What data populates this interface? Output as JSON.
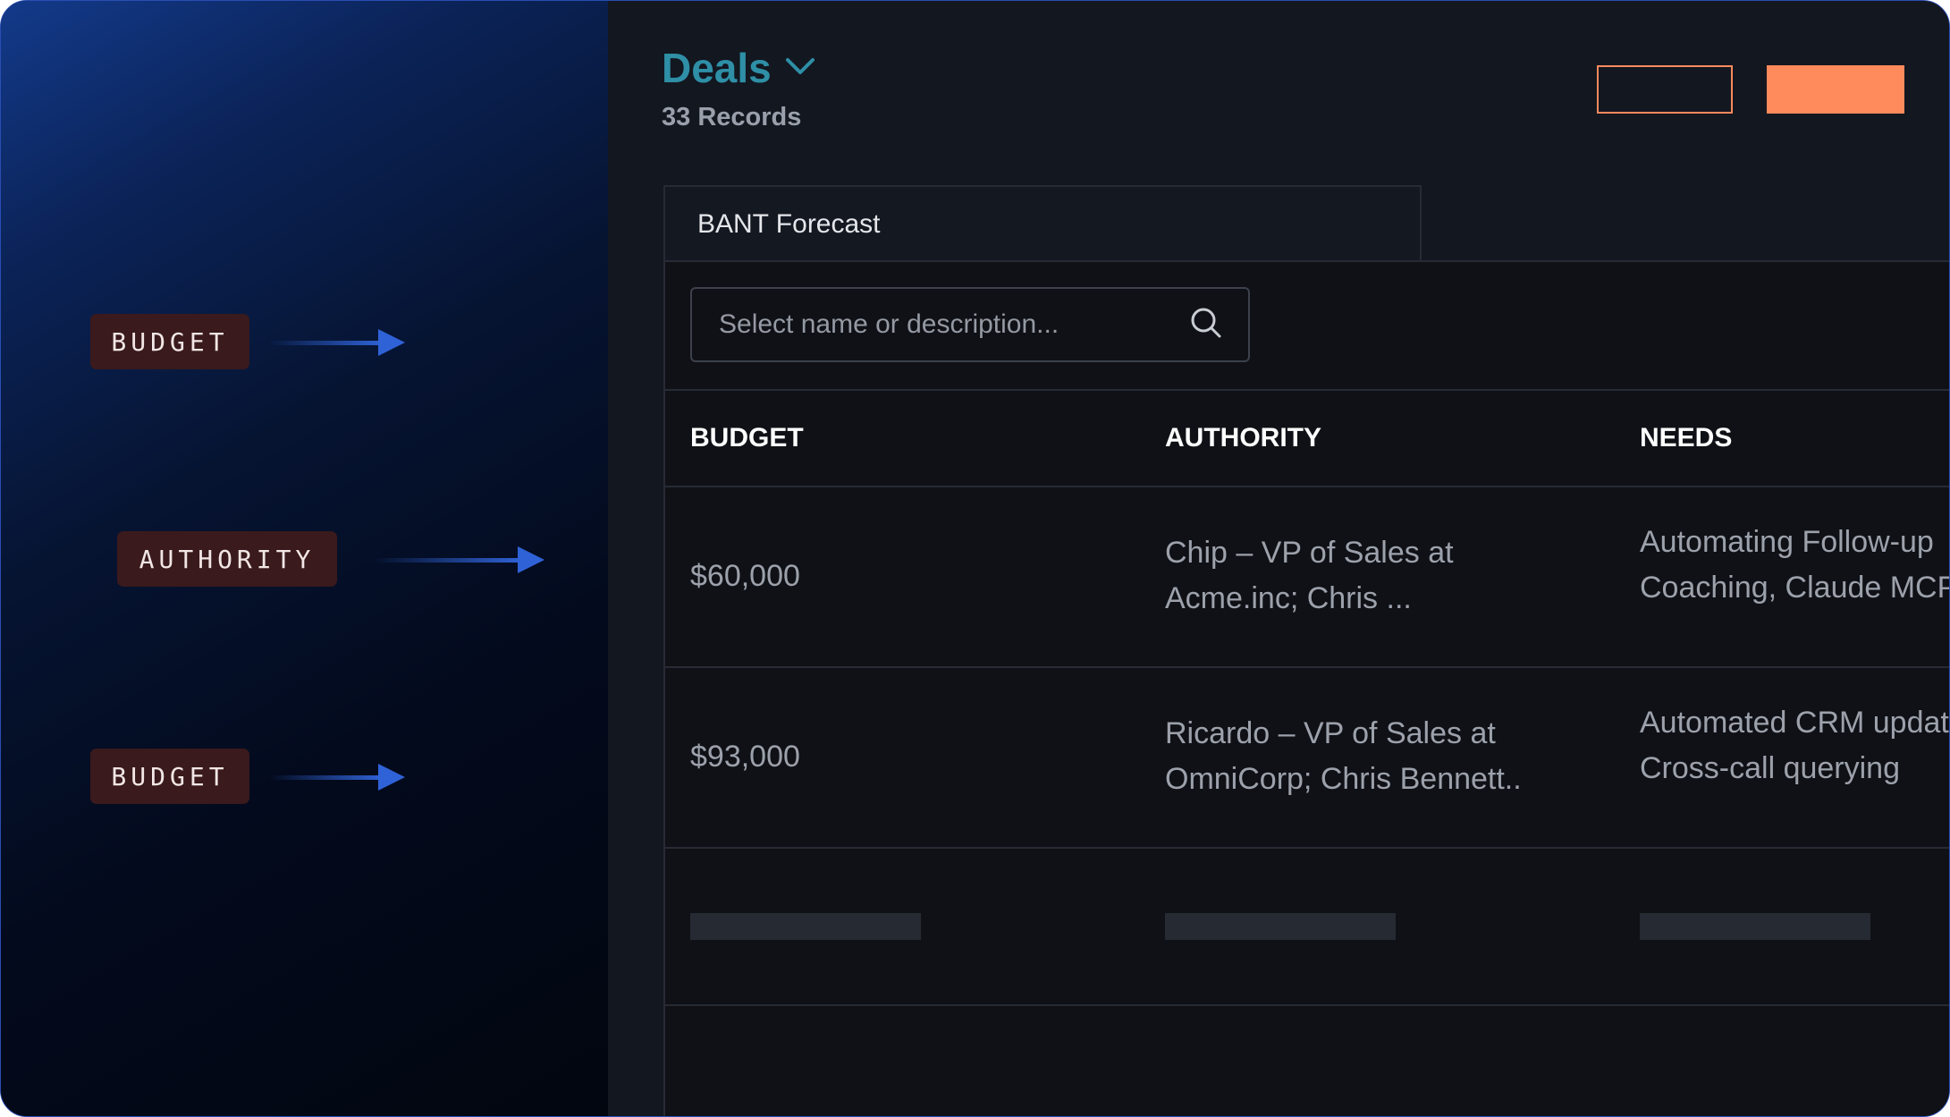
{
  "annotations": [
    {
      "label": "BUDGET"
    },
    {
      "label": "AUTHORITY"
    },
    {
      "label": "BUDGET"
    }
  ],
  "header": {
    "title": "Deals",
    "record_count": "33 Records"
  },
  "view_tab": {
    "label": "BANT Forecast"
  },
  "search": {
    "placeholder": "Select name or description..."
  },
  "table": {
    "columns": [
      "BUDGET",
      "AUTHORITY",
      "NEEDS"
    ],
    "rows": [
      {
        "budget": "$60,000",
        "authority_line1": "Chip – VP of Sales at",
        "authority_line2": "Acme.inc; Chris ...",
        "needs_line1": "Automating Follow-up",
        "needs_line2": "Coaching, Claude MCP"
      },
      {
        "budget": "$93,000",
        "authority_line1": "Ricardo – VP of Sales at",
        "authority_line2": "OmniCorp; Chris Bennett..",
        "needs_line1": "Automated CRM updates",
        "needs_line2": "Cross-call querying"
      }
    ]
  },
  "colors": {
    "accent": "#ff8a5c",
    "title": "#2e8fa6",
    "tag_bg": "#3a1a1c",
    "arrow": "#2f62d6"
  },
  "icons": {
    "title_dropdown": "chevron-down-icon",
    "search": "search-icon",
    "annotation_arrow": "arrow-right-icon"
  }
}
